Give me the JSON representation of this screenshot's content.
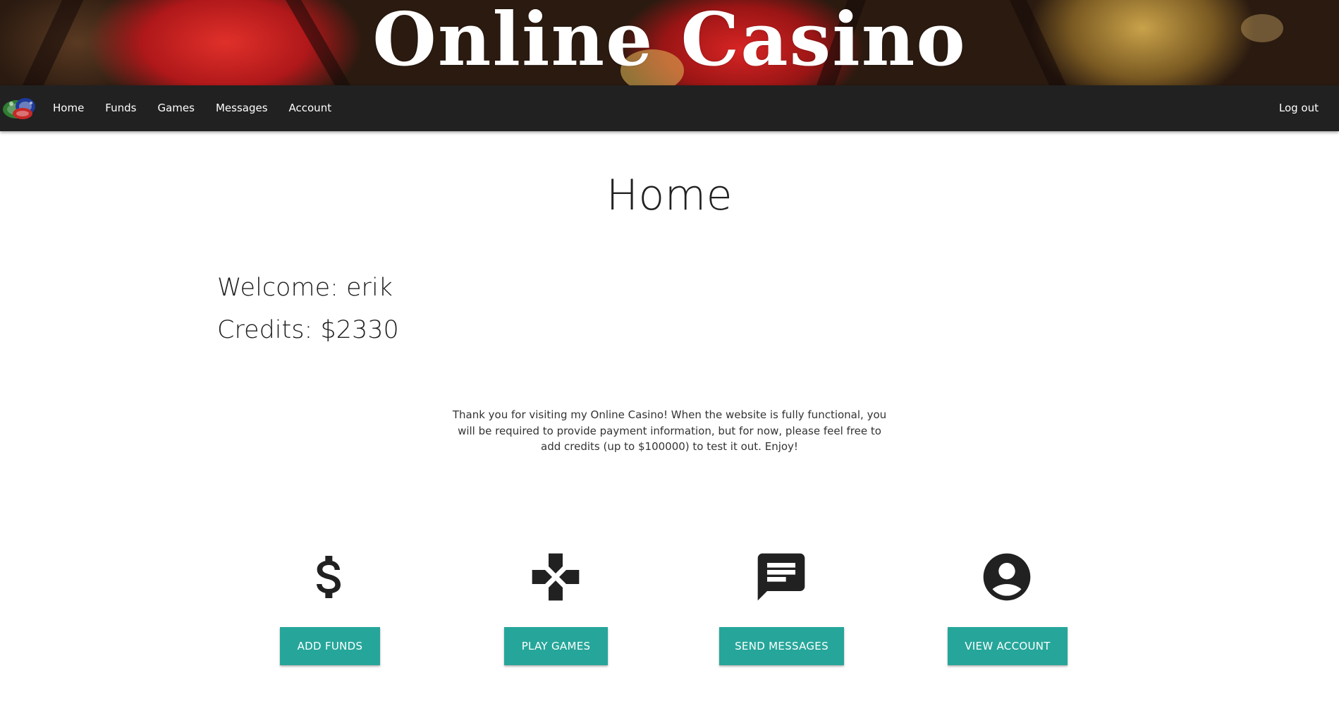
{
  "banner": {
    "title": "Online Casino"
  },
  "nav": {
    "logo_icon": "poker-chips-icon",
    "links": [
      {
        "label": "Home"
      },
      {
        "label": "Funds"
      },
      {
        "label": "Games"
      },
      {
        "label": "Messages"
      },
      {
        "label": "Account"
      }
    ],
    "logout": "Log out"
  },
  "main": {
    "title": "Home",
    "welcome": "Welcome: erik",
    "credits": "Credits: $2330",
    "intro": "Thank you for visiting my Online Casino! When the website is fully functional, you will be required to provide payment information, but for now, please feel free to add credits (up to $100000) to test it out. Enjoy!"
  },
  "actions": [
    {
      "icon": "dollar-icon",
      "label": "ADD FUNDS"
    },
    {
      "icon": "gamepad-icon",
      "label": "PLAY GAMES"
    },
    {
      "icon": "message-icon",
      "label": "SEND MESSAGES"
    },
    {
      "icon": "account-circle-icon",
      "label": "VIEW ACCOUNT"
    }
  ],
  "colors": {
    "navbar": "#212121",
    "accent": "#26a69a",
    "text": "#212121"
  }
}
